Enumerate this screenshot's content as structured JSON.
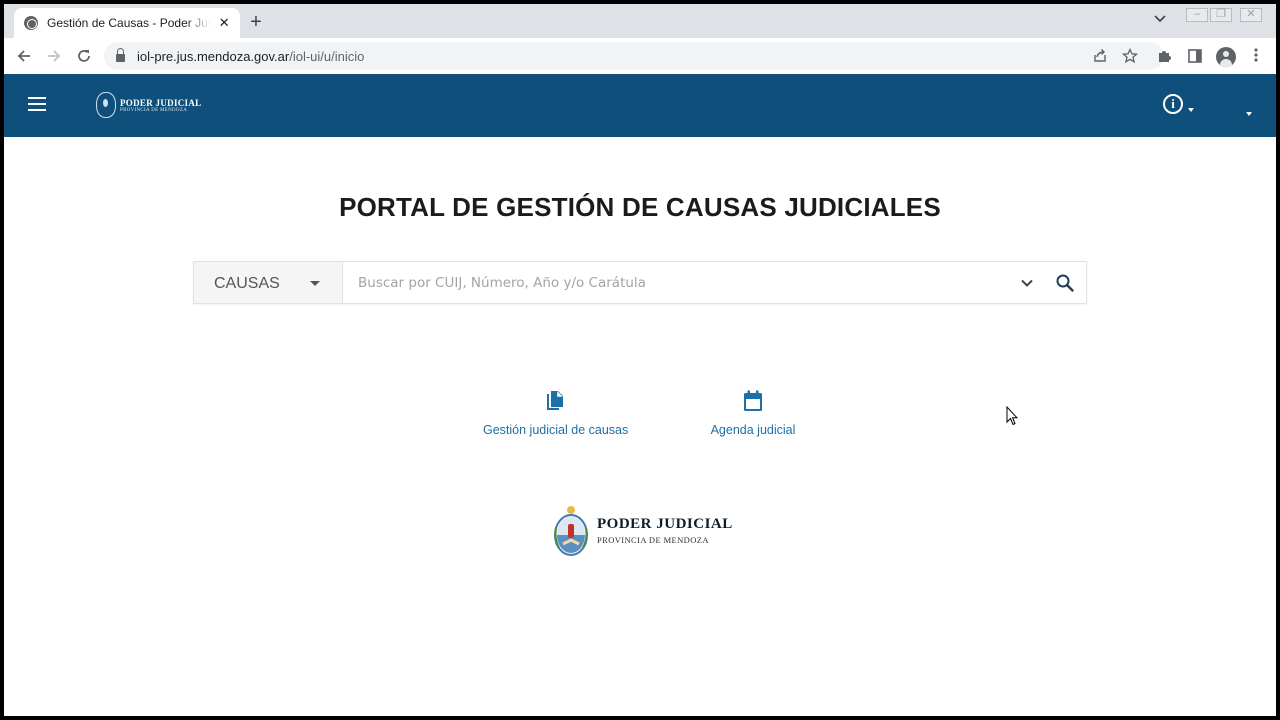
{
  "browser": {
    "tab_title": "Gestión de Causas - Poder Judicial",
    "tab_close": "✕",
    "new_tab": "+",
    "url_domain": "iol-pre.jus.mendoza.gov.ar",
    "url_path": "/iol-ui/u/inicio"
  },
  "header": {
    "brand_line1": "PODER JUDICIAL",
    "brand_line2": "PROVINCIA DE MENDOZA",
    "info_glyph": "i"
  },
  "main": {
    "title": "PORTAL DE GESTIÓN DE CAUSAS JUDICIALES",
    "search": {
      "category": "CAUSAS",
      "placeholder": "Buscar por CUIJ, Número, Año y/o Carátula"
    },
    "shortcuts": [
      {
        "label": "Gestión judicial de causas",
        "icon": "file-copy-icon"
      },
      {
        "label": "Agenda judicial",
        "icon": "calendar-icon"
      }
    ],
    "footer_logo": {
      "line1": "PODER JUDICIAL",
      "line2": "PROVINCIA DE MENDOZA"
    }
  },
  "colors": {
    "header_bg": "#0f4f7b",
    "accent": "#1d6fa8"
  }
}
